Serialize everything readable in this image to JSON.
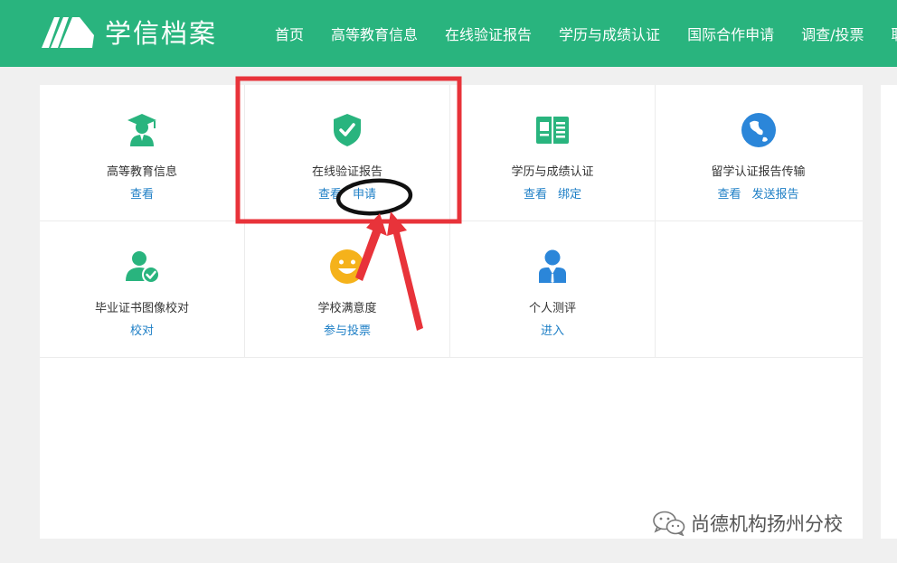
{
  "header": {
    "logo_text": "学信档案",
    "nav": [
      "首页",
      "高等教育信息",
      "在线验证报告",
      "学历与成绩认证",
      "国际合作申请",
      "调查/投票",
      "联"
    ]
  },
  "colors": {
    "brand": "#29b47e",
    "link": "#1e7fc6",
    "annotation_red": "#e8333a"
  },
  "cards": [
    {
      "icon": "graduate-icon",
      "title": "高等教育信息",
      "links": [
        "查看"
      ]
    },
    {
      "icon": "shield-check-icon",
      "title": "在线验证报告",
      "links": [
        "查看",
        "申请"
      ]
    },
    {
      "icon": "book-icon",
      "title": "学历与成绩认证",
      "links": [
        "查看",
        "绑定"
      ]
    },
    {
      "icon": "globe-icon",
      "title": "留学认证报告传输",
      "links": [
        "查看",
        "发送报告"
      ]
    },
    {
      "icon": "user-check-icon",
      "title": "毕业证书图像校对",
      "links": [
        "校对"
      ]
    },
    {
      "icon": "smiley-icon",
      "title": "学校满意度",
      "links": [
        "参与投票"
      ]
    },
    {
      "icon": "person-suit-icon",
      "title": "个人测评",
      "links": [
        "进入"
      ]
    }
  ],
  "watermark": {
    "text": "尚德机构扬州分校"
  }
}
